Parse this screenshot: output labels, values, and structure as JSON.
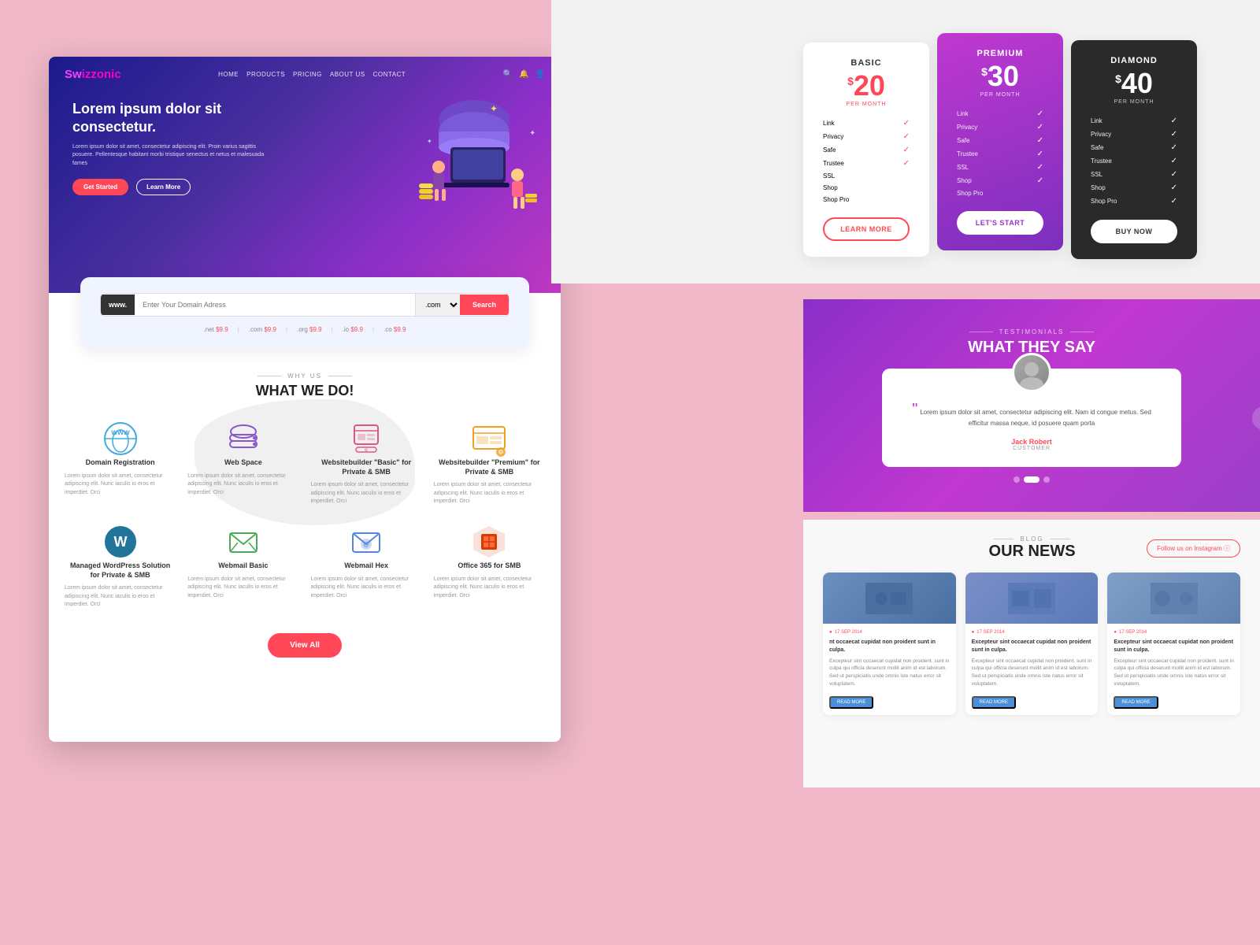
{
  "brand": {
    "name": "Sw",
    "name2": "izzonic",
    "logoHighlight": "w"
  },
  "nav": {
    "links": [
      "HOME",
      "PRODUCTS",
      "PRICING",
      "ABOUT US",
      "CONTACT"
    ],
    "icons": [
      "search",
      "bell",
      "user"
    ]
  },
  "hero": {
    "title": "Lorem ipsum dolor sit consectetur.",
    "body": "Lorem ipsum dolor sit amet, consectetur adipiscing elit.\nProin varius sagittis posuere. Pellentesque habitant\nmorbi tristique senectus et netus et malesuada fames",
    "btn_primary": "Get Started",
    "btn_secondary": "Learn More"
  },
  "domain_search": {
    "placeholder": "Enter Your Domain Adress",
    "prefix": "www.",
    "extension": ".com ▾",
    "btn": "Search",
    "prices": [
      {
        "ext": ".net",
        "price": "$9.9"
      },
      {
        "ext": ".com",
        "price": "$9.9"
      },
      {
        "ext": ".org",
        "price": "$9.9"
      },
      {
        "ext": ".io",
        "price": "$9.9"
      },
      {
        "ext": ".co",
        "price": "$9.9"
      }
    ]
  },
  "what_we_do": {
    "subtitle": "WHY US",
    "title": "WHAT WE DO!",
    "services_row1": [
      {
        "name": "Domain Registration",
        "desc": "Lorem ipsum dolor sit amet, consectetur adipiscing elit. Nunc iaculis io eros et imperdiet. Orci",
        "icon": "domain"
      },
      {
        "name": "Web Space",
        "desc": "Lorem ipsum dolor sit amet, consectetur adipiscing elit. Nunc iaculis io eros et imperdiet. Orci",
        "icon": "cloud"
      },
      {
        "name": "Websitebuilder \"Basic\" for Private & SMB",
        "desc": "Lorem ipsum dolor sit amet, consectetur adipiscing elit. Nunc iaculis io eros et imperdiet. Orci",
        "icon": "builder-basic"
      },
      {
        "name": "Websitebuilder \"Premium\" for Private & SMB",
        "desc": "Lorem ipsum dolor sit amet, consectetur adipiscing elit. Nunc iaculis io eros et imperdiet. Orci",
        "icon": "builder-premium"
      }
    ],
    "services_row2": [
      {
        "name": "Managed WordPress Solution for Private & SMB",
        "desc": "Lorem ipsum dolor sit amet, consectetur adipiscing elit. Nunc iaculis io eros et imperdiet. Orci",
        "icon": "wordpress"
      },
      {
        "name": "Webmail Basic",
        "desc": "Lorem ipsum dolor sit amet, consectetur adipiscing elit. Nunc iaculis io eros et imperdiet. Orci",
        "icon": "mail-basic"
      },
      {
        "name": "Webmail Hex",
        "desc": "Lorem ipsum dolor sit amet, consectetur adipiscing elit. Nunc iaculis io eros et imperdiet. Orci",
        "icon": "mail-hex"
      },
      {
        "name": "Office 365 for SMB",
        "desc": "Lorem ipsum dolor sit amet, consectetur adipiscing elit. Nunc iaculis io eros et imperdiet. Orci",
        "icon": "office365"
      }
    ],
    "view_all": "View All"
  },
  "pricing": {
    "cards": [
      {
        "id": "basic",
        "name": "BASIC",
        "price": "20",
        "per_month": "PER MONTH",
        "features": [
          "Link",
          "Privacy",
          "Safe",
          "Trustee",
          "SSL",
          "Shop",
          "Shop Pro"
        ],
        "checked": [
          true,
          true,
          true,
          true,
          false,
          false,
          false
        ],
        "btn": "LEARN MORE"
      },
      {
        "id": "premium",
        "name": "PREMIUM",
        "price": "30",
        "per_month": "PER MONTH",
        "features": [
          "Link",
          "Privacy",
          "Safe",
          "Trustee",
          "SSL",
          "Shop",
          "Shop Pro"
        ],
        "checked": [
          true,
          true,
          true,
          true,
          true,
          true,
          false
        ],
        "btn": "LET'S START"
      },
      {
        "id": "diamond",
        "name": "DIAMOND",
        "price": "40",
        "per_month": "PER MONTH",
        "features": [
          "Link",
          "Privacy",
          "Safe",
          "Trustee",
          "SSL",
          "Shop",
          "Shop Pro"
        ],
        "checked": [
          true,
          true,
          true,
          true,
          true,
          true,
          true
        ],
        "btn": "BUY NOW"
      }
    ]
  },
  "testimonials": {
    "subtitle": "TESTIMONIALS",
    "title": "WHAT THEY SAY",
    "review": "Lorem ipsum dolor sit amet, consectetur adipiscing elit. Nam id congue metus. Sed efficitur massa neque, id posuere quam porta",
    "author_name": "Jack Robert",
    "author_role": "CUSTOMER",
    "dots": [
      false,
      true,
      false
    ]
  },
  "blog": {
    "subtitle": "BLOG",
    "title": "OUR NEWS",
    "follow_btn": "Follow us on Instagram ⓘ",
    "articles": [
      {
        "headline": "nt occaecat cupidat non proident sunt in culpa.",
        "date": "17 SEP 2014",
        "excerpt": "Excepteur sint occaecat cupidat non proident. sunt in culpa qui officia deserunt mollit anim id est laborum. Sed ut perspiciatis unde omnis iste natus error sit voluptatem.",
        "btn": "READ MORE",
        "img_color": "#6a8fc0"
      },
      {
        "headline": "Excepteur sint occaecat cupidat non proident sunt in culpa.",
        "date": "17 SEP 2014",
        "excerpt": "Excepteur sint occaecat cupidat non proident. sunt in culpa qui officia deserunt mollit anim id est laborum. Sed ut perspiciatis unde omnis iste natus error sit voluptatem.",
        "btn": "READ MORE",
        "img_color": "#5a7ab0"
      },
      {
        "headline": "Excepteur sint occaecat cupidat non proident sunt in culpa.",
        "date": "17 SEP 2014",
        "excerpt": "Excepteur sint occaecat cupidat non proident. sunt in culpa qui officia deserunt mollit anim id est laborum. Sed ut perspiciatis unde omnis iste natus error sit voluptatem.",
        "btn": "READ MORE",
        "img_color": "#708ab8"
      }
    ]
  }
}
